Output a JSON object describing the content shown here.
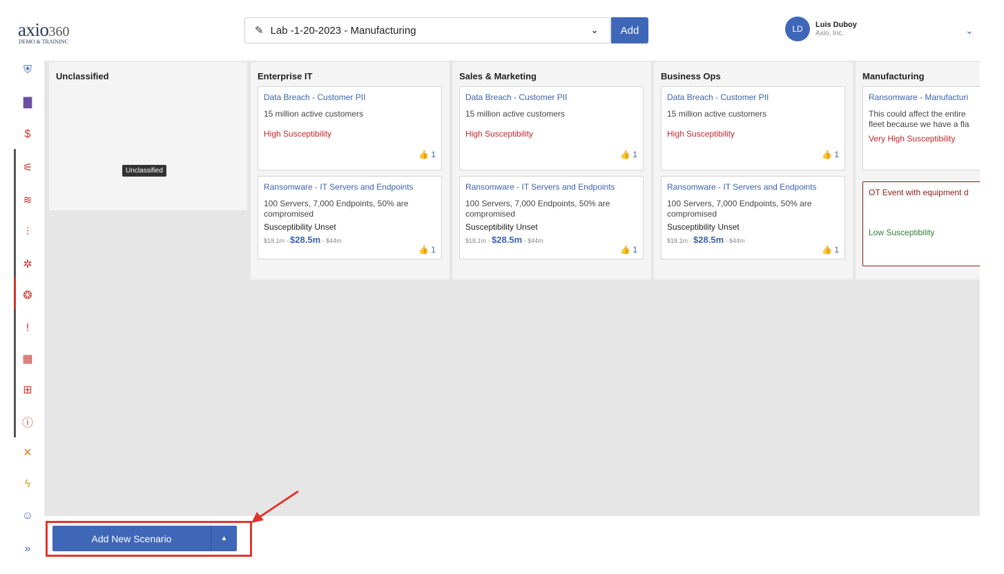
{
  "header": {
    "logo_word": "axio",
    "logo_num": "360",
    "logo_sub": "DEMO & TRAININC",
    "assessment": "Lab -1-20-2023 - Manufacturing",
    "add_label": "Add",
    "user_initials": "LD",
    "user_name": "Luis Duboy",
    "user_org": "Axio, Inc."
  },
  "sidebar": {
    "items": [
      {
        "icon": "shield-check-icon",
        "glyph": "⛨",
        "color": "#3f67b8"
      },
      {
        "icon": "document-icon",
        "glyph": "▇",
        "color": "#6a4fa3"
      },
      {
        "icon": "dollar-icon",
        "glyph": "$",
        "color": "#c9372c"
      },
      {
        "icon": "sliders-icon",
        "glyph": "⚟",
        "color": "#c9372c"
      },
      {
        "icon": "layers-icon",
        "glyph": "≋",
        "color": "#c9372c"
      },
      {
        "icon": "chart-icon",
        "glyph": "⫶",
        "color": "#c9372c"
      },
      {
        "icon": "bug-icon",
        "glyph": "✲",
        "color": "#c9372c"
      },
      {
        "icon": "brain-icon",
        "glyph": "❂",
        "color": "#c9372c"
      },
      {
        "icon": "alert-icon",
        "glyph": "!",
        "color": "#c9372c"
      },
      {
        "icon": "table-icon",
        "glyph": "▦",
        "color": "#c9372c"
      },
      {
        "icon": "map-icon",
        "glyph": "⊞",
        "color": "#c9372c"
      },
      {
        "icon": "info-icon",
        "glyph": "ⓘ",
        "color": "#c9372c"
      },
      {
        "icon": "tools-icon",
        "glyph": "✕",
        "color": "#d9822b"
      },
      {
        "icon": "bolt-icon",
        "glyph": "ϟ",
        "color": "#e0a020"
      },
      {
        "icon": "smiley-icon",
        "glyph": "☺",
        "color": "#3f67b8"
      },
      {
        "icon": "expand-icon",
        "glyph": "»",
        "color": "#3f67b8"
      }
    ]
  },
  "columns": [
    {
      "title": "Unclassified",
      "cards": []
    },
    {
      "title": "Enterprise IT",
      "cards": [
        {
          "title": "Data Breach - Customer PII",
          "desc": "15 million active customers",
          "susc": "High Susceptibility",
          "likes": "1"
        },
        {
          "title": "Ransomware - IT Servers and Endpoints",
          "desc": "100 Servers, 7,000 Endpoints, 50% are compromised",
          "susc": "Susceptibility Unset",
          "range_low": "$18.1m",
          "range_mid": "$28.5m",
          "range_high": "$44m",
          "likes": "1"
        }
      ]
    },
    {
      "title": "Sales & Marketing",
      "cards": [
        {
          "title": "Data Breach - Customer PII",
          "desc": "15 million active customers",
          "susc": "High Susceptibility",
          "likes": "1"
        },
        {
          "title": "Ransomware - IT Servers and Endpoints",
          "desc": "100 Servers, 7,000 Endpoints, 50% are compromised",
          "susc": "Susceptibility Unset",
          "range_low": "$18.1m",
          "range_mid": "$28.5m",
          "range_high": "$44m",
          "likes": "1"
        }
      ]
    },
    {
      "title": "Business Ops",
      "cards": [
        {
          "title": "Data Breach - Customer PII",
          "desc": "15 million active customers",
          "susc": "High Susceptibility",
          "likes": "1"
        },
        {
          "title": "Ransomware - IT Servers and Endpoints",
          "desc": "100 Servers, 7,000 Endpoints, 50% are compromised",
          "susc": "Susceptibility Unset",
          "range_low": "$18.1m",
          "range_mid": "$28.5m",
          "range_high": "$44m",
          "likes": "1"
        }
      ]
    },
    {
      "title": "Manufacturing",
      "cards": [
        {
          "title": "Ransomware - Manufacturi",
          "desc": "This could affect the entire fleet because we have a fla",
          "susc": "Very High Susceptibility"
        },
        {
          "title": "OT Event with equipment d",
          "susc": "Low Susceptibility"
        }
      ]
    }
  ],
  "tooltip": "Unclassified",
  "footer": {
    "add_scenario": "Add New Scenario"
  },
  "colors": {
    "accent": "#3f67b8",
    "high": "#c0272d",
    "low": "#2e7d32",
    "annotation": "#e0362a"
  }
}
